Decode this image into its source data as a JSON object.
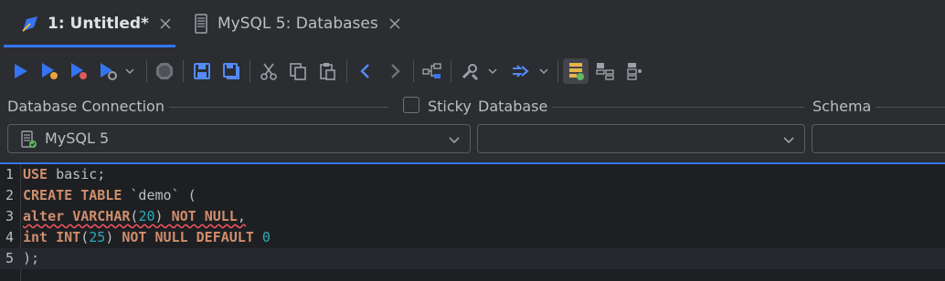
{
  "tabs": [
    {
      "label": "1: Untitled*",
      "active": true,
      "icon": "sql-script-icon"
    },
    {
      "label": "MySQL 5: Databases",
      "active": false,
      "icon": "database-server-icon"
    }
  ],
  "toolbar": {
    "buttons": [
      "run-icon",
      "run-selection-icon",
      "run-script-icon",
      "run-options-icon",
      "stop-icon",
      "save-icon",
      "save-all-icon",
      "cut-icon",
      "copy-icon",
      "paste-icon",
      "back-icon",
      "forward-icon",
      "structure-icon",
      "tools-icon",
      "execute-mode-icon",
      "tree-view-icon",
      "grid-view-icon",
      "stack-view-icon"
    ]
  },
  "connection": {
    "label_connection": "Database Connection",
    "sticky_label": "Sticky",
    "sticky_checked": false,
    "label_database": "Database",
    "label_schema": "Schema",
    "connection_value": "MySQL 5",
    "database_value": "",
    "schema_value": ""
  },
  "editor": {
    "lines": [
      {
        "n": "1",
        "tokens": [
          {
            "t": "USE",
            "k": "kw"
          },
          {
            "t": " basic;",
            "k": ""
          }
        ]
      },
      {
        "n": "2",
        "tokens": [
          {
            "t": "CREATE",
            "k": "kw"
          },
          {
            "t": " ",
            "k": ""
          },
          {
            "t": "TABLE",
            "k": "kw"
          },
          {
            "t": " `demo` (",
            "k": ""
          }
        ]
      },
      {
        "n": "3",
        "tokens": [
          {
            "t": "alter",
            "k": "kw err"
          },
          {
            "t": " ",
            "k": "err"
          },
          {
            "t": "VARCHAR",
            "k": "kw err"
          },
          {
            "t": "(",
            "k": "err"
          },
          {
            "t": "20",
            "k": "num err"
          },
          {
            "t": ") ",
            "k": "err"
          },
          {
            "t": "NOT",
            "k": "kw err"
          },
          {
            "t": " ",
            "k": "err"
          },
          {
            "t": "NULL",
            "k": "kw err"
          },
          {
            "t": ",",
            "k": "err"
          }
        ]
      },
      {
        "n": "4",
        "tokens": [
          {
            "t": "int",
            "k": "kw"
          },
          {
            "t": " ",
            "k": ""
          },
          {
            "t": "INT",
            "k": "kw"
          },
          {
            "t": "(",
            "k": ""
          },
          {
            "t": "25",
            "k": "num"
          },
          {
            "t": ") ",
            "k": ""
          },
          {
            "t": "NOT",
            "k": "kw"
          },
          {
            "t": " ",
            "k": ""
          },
          {
            "t": "NULL",
            "k": "kw"
          },
          {
            "t": " ",
            "k": ""
          },
          {
            "t": "DEFAULT",
            "k": "kw"
          },
          {
            "t": " ",
            "k": ""
          },
          {
            "t": "0",
            "k": "num"
          }
        ]
      },
      {
        "n": "5",
        "tokens": [
          {
            "t": ");",
            "k": ""
          }
        ]
      }
    ],
    "current_line": 5
  },
  "colors": {
    "accent": "#3574f0",
    "keyword": "#cf8e6d",
    "number": "#2aacb8",
    "error": "#f75464"
  }
}
